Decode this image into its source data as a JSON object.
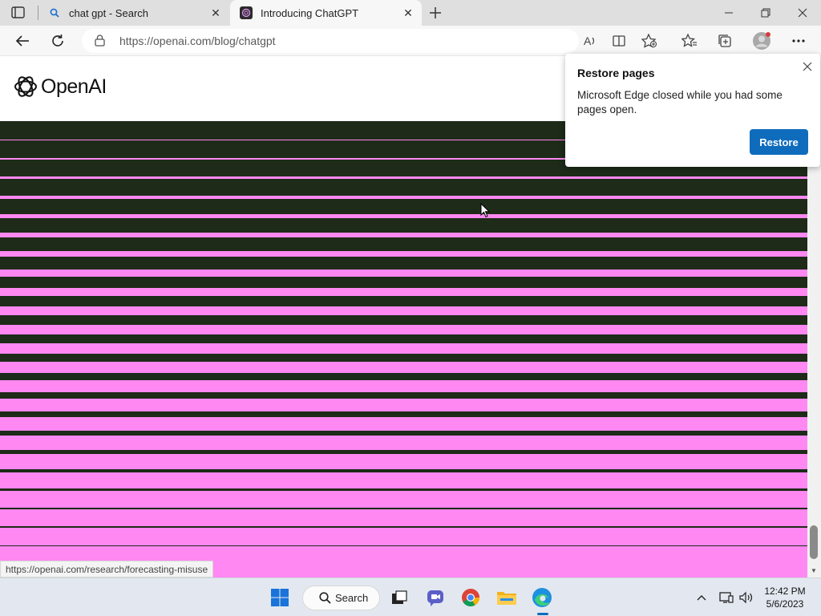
{
  "browser": {
    "tabs": [
      {
        "title": "chat gpt - Search",
        "icon": "search-icon",
        "active": false
      },
      {
        "title": "Introducing ChatGPT",
        "icon": "openai-favicon",
        "active": true
      }
    ],
    "url": "https://openai.com/blog/chatgpt"
  },
  "page": {
    "logo_text": "OpenAI",
    "hero_dark_color": "#1d2b18",
    "hero_stripe_color": "#ff88f2"
  },
  "status_link": "https://openai.com/research/forecasting-misuse",
  "popup": {
    "title": "Restore pages",
    "message": "Microsoft Edge closed while you had some pages open.",
    "button_label": "Restore"
  },
  "taskbar": {
    "search_label": "Search",
    "apps": [
      "windows-start-icon",
      "task-view-icon",
      "teams-chat-icon",
      "chrome-icon",
      "file-explorer-icon",
      "edge-icon"
    ],
    "time": "12:42 PM",
    "date": "5/6/2023"
  },
  "colors": {
    "accent": "#0f6cbd",
    "hero_dark": "#1d2b18",
    "hero_pink": "#ff88f2"
  }
}
